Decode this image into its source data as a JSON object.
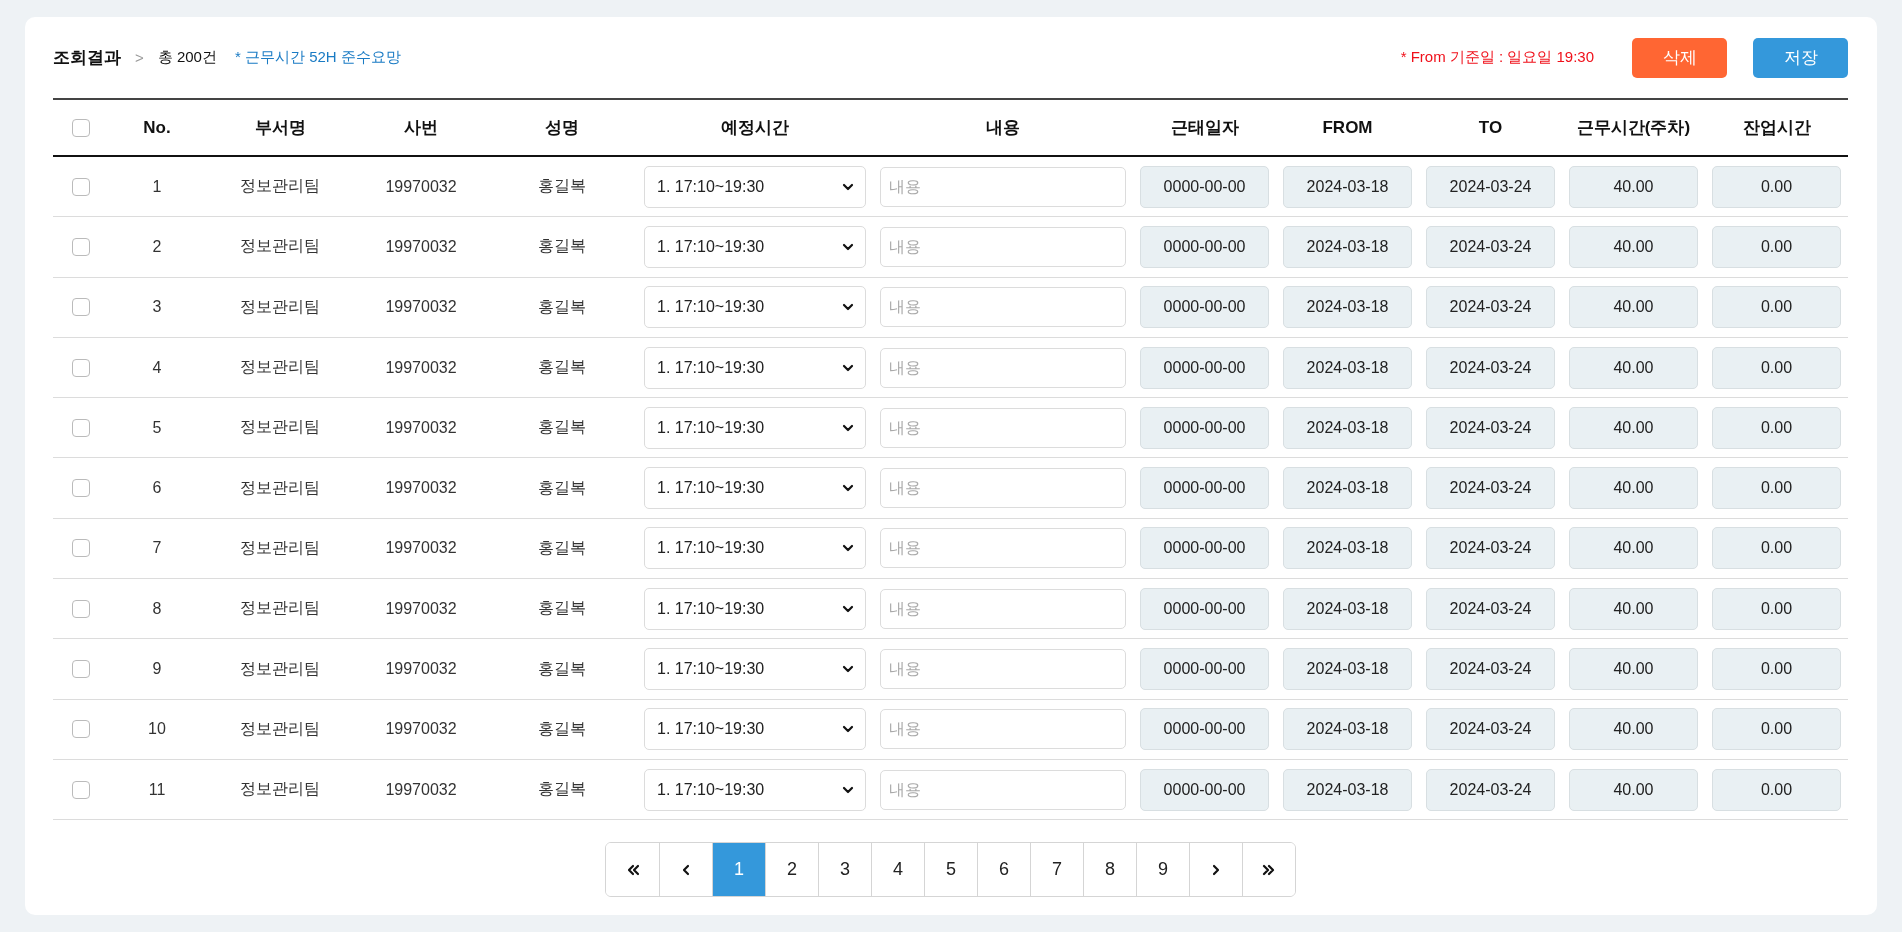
{
  "header": {
    "title": "조회결과",
    "separator": ">",
    "total": "총 200건",
    "notice": "* 근무시간 52H 준수요망",
    "basis_note": "* From 기준일 : 일요일 19:30",
    "buttons": [
      {
        "kind": "delete",
        "label": "삭제"
      },
      {
        "kind": "save",
        "label": "저장"
      }
    ]
  },
  "table": {
    "select_all": {
      "checked": false
    },
    "columns": [
      "No.",
      "부서명",
      "사번",
      "성명",
      "예정시간",
      "내용",
      "근태일자",
      "FROM",
      "TO",
      "근무시간(주차)",
      "잔업시간"
    ],
    "rows": [
      {
        "checked": false,
        "no": "1",
        "dept": "정보관리팀",
        "emp_no": "19970032",
        "name": "홍길복",
        "schedule": "1. 17:10~19:30",
        "content_placeholder": "내용",
        "date": "0000-00-00",
        "from": "2024-03-18",
        "to": "2024-03-24",
        "hours": "40.00",
        "overtime": "0.00"
      },
      {
        "checked": false,
        "no": "2",
        "dept": "정보관리팀",
        "emp_no": "19970032",
        "name": "홍길복",
        "schedule": "1. 17:10~19:30",
        "content_placeholder": "내용",
        "date": "0000-00-00",
        "from": "2024-03-18",
        "to": "2024-03-24",
        "hours": "40.00",
        "overtime": "0.00"
      },
      {
        "checked": false,
        "no": "3",
        "dept": "정보관리팀",
        "emp_no": "19970032",
        "name": "홍길복",
        "schedule": "1. 17:10~19:30",
        "content_placeholder": "내용",
        "date": "0000-00-00",
        "from": "2024-03-18",
        "to": "2024-03-24",
        "hours": "40.00",
        "overtime": "0.00"
      },
      {
        "checked": false,
        "no": "4",
        "dept": "정보관리팀",
        "emp_no": "19970032",
        "name": "홍길복",
        "schedule": "1. 17:10~19:30",
        "content_placeholder": "내용",
        "date": "0000-00-00",
        "from": "2024-03-18",
        "to": "2024-03-24",
        "hours": "40.00",
        "overtime": "0.00"
      },
      {
        "checked": false,
        "no": "5",
        "dept": "정보관리팀",
        "emp_no": "19970032",
        "name": "홍길복",
        "schedule": "1. 17:10~19:30",
        "content_placeholder": "내용",
        "date": "0000-00-00",
        "from": "2024-03-18",
        "to": "2024-03-24",
        "hours": "40.00",
        "overtime": "0.00"
      },
      {
        "checked": false,
        "no": "6",
        "dept": "정보관리팀",
        "emp_no": "19970032",
        "name": "홍길복",
        "schedule": "1. 17:10~19:30",
        "content_placeholder": "내용",
        "date": "0000-00-00",
        "from": "2024-03-18",
        "to": "2024-03-24",
        "hours": "40.00",
        "overtime": "0.00"
      },
      {
        "checked": false,
        "no": "7",
        "dept": "정보관리팀",
        "emp_no": "19970032",
        "name": "홍길복",
        "schedule": "1. 17:10~19:30",
        "content_placeholder": "내용",
        "date": "0000-00-00",
        "from": "2024-03-18",
        "to": "2024-03-24",
        "hours": "40.00",
        "overtime": "0.00"
      },
      {
        "checked": false,
        "no": "8",
        "dept": "정보관리팀",
        "emp_no": "19970032",
        "name": "홍길복",
        "schedule": "1. 17:10~19:30",
        "content_placeholder": "내용",
        "date": "0000-00-00",
        "from": "2024-03-18",
        "to": "2024-03-24",
        "hours": "40.00",
        "overtime": "0.00"
      },
      {
        "checked": false,
        "no": "9",
        "dept": "정보관리팀",
        "emp_no": "19970032",
        "name": "홍길복",
        "schedule": "1. 17:10~19:30",
        "content_placeholder": "내용",
        "date": "0000-00-00",
        "from": "2024-03-18",
        "to": "2024-03-24",
        "hours": "40.00",
        "overtime": "0.00"
      },
      {
        "checked": false,
        "no": "10",
        "dept": "정보관리팀",
        "emp_no": "19970032",
        "name": "홍길복",
        "schedule": "1. 17:10~19:30",
        "content_placeholder": "내용",
        "date": "0000-00-00",
        "from": "2024-03-18",
        "to": "2024-03-24",
        "hours": "40.00",
        "overtime": "0.00"
      },
      {
        "checked": false,
        "no": "11",
        "dept": "정보관리팀",
        "emp_no": "19970032",
        "name": "홍길복",
        "schedule": "1. 17:10~19:30",
        "content_placeholder": "내용",
        "date": "0000-00-00",
        "from": "2024-03-18",
        "to": "2024-03-24",
        "hours": "40.00",
        "overtime": "0.00"
      }
    ]
  },
  "pagination": {
    "pages": [
      {
        "label": "1",
        "selected": true
      },
      {
        "label": "2",
        "selected": false
      },
      {
        "label": "3",
        "selected": false
      },
      {
        "label": "4",
        "selected": false
      },
      {
        "label": "5",
        "selected": false
      },
      {
        "label": "6",
        "selected": false
      },
      {
        "label": "7",
        "selected": false
      },
      {
        "label": "8",
        "selected": false
      },
      {
        "label": "9",
        "selected": false
      }
    ]
  }
}
